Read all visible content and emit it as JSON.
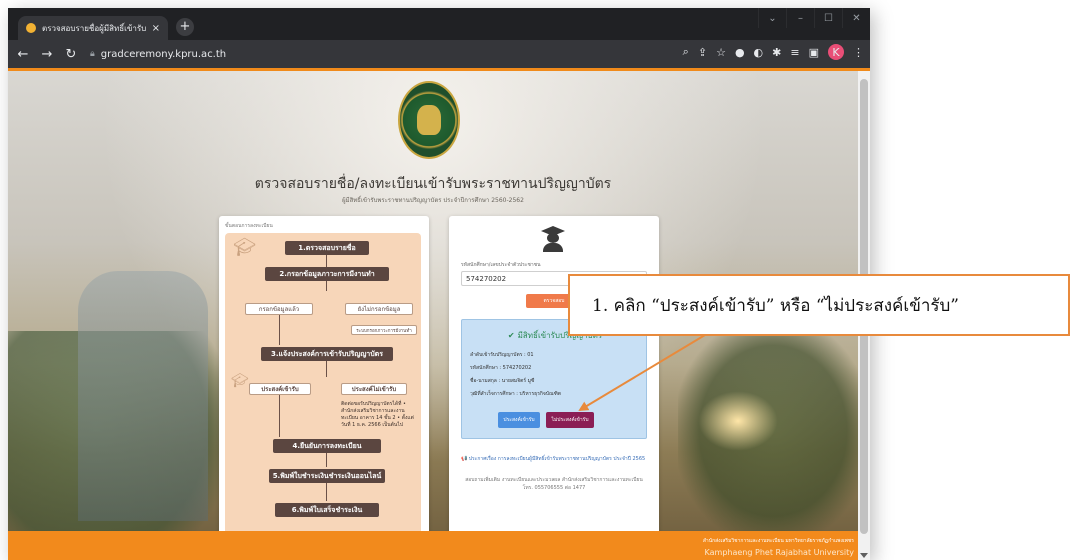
{
  "browser": {
    "tab_title": "ตรวจสอบรายชื่อผู้มีสิทธิ์เข้ารับพร",
    "tab_close": "×",
    "new_tab": "+",
    "url": "gradceremony.kpru.ac.th",
    "profile_initial": "K",
    "window_controls": [
      "⌄",
      "–",
      "☐",
      "✕"
    ],
    "icons": [
      "back-icon",
      "forward-icon",
      "reload-icon",
      "home-icon",
      "lock-icon",
      "zoom-icon",
      "share-icon",
      "bookmark-star-icon",
      "extension-icon",
      "extension-icon",
      "puzzle-icon",
      "reading-list-icon",
      "sidepanel-icon",
      "profile-icon",
      "menu-icon"
    ],
    "accent_color": "#f08a1a"
  },
  "page": {
    "title": "ตรวจสอบรายชื่อ/ลงทะเบียนเข้ารับพระราชทานปริญญาบัตร",
    "subtitle": "ผู้มีสิทธิ์เข้ารับพระราชทานปริญญาบัตร ประจำปีการศึกษา 2560-2562"
  },
  "steps": {
    "heading": "ขั้นตอนการลงทะเบียน",
    "step1": "1.ตรวจสอบรายชื่อ",
    "step2": "2.กรอกข้อมูลภาวะการมีงานทำ",
    "branch_done": "กรอกข้อมูลแล้ว",
    "branch_not_done": "ยังไม่กรอกข้อมูล",
    "branch_system": "ระบบกรอกภาวะการมีงานทำ",
    "step3": "3.แจ้งประสงค์การเข้ารับปริญญาบัตร",
    "option_accept": "ประสงค์เข้ารับ",
    "option_decline": "ประสงค์ไม่เข้ารับ",
    "decline_note": "ติดต่อขอรับปริญญาบัตรได้ที่ • สำนักส่งเสริมวิชาการและงานทะเบียน อาคาร 14 ชั้น 2 • ตั้งแต่วันที่ 1 ธ.ค. 2566 เป็นต้นไป",
    "step4": "4.ยืนยันการลงทะเบียน",
    "step5": "5.พิมพ์ใบชำระเงินชำระเงินออนไลน์",
    "step6": "6.พิมพ์ใบเสร็จชำระเงิน"
  },
  "login": {
    "field_label": "รหัสนักศึกษา/เลขประจำตัวประชาชน",
    "student_id": "574270202",
    "check_button": "ตรวจสอบ",
    "eligible_text": "มีสิทธิ์เข้ารับปริญญาบัตร",
    "info": [
      "ลำดับเข้ารับปริญญาบัตร : 01",
      "รหัสนักศึกษา : 574270202",
      "ชื่อ-นามสกุล : นายสมจิตร์ มูซี",
      "วุฒิที่สำเร็จการศึกษา : บริหารธุรกิจบัณฑิต"
    ],
    "accept_button": "ประสงค์เข้ารับ",
    "decline_button": "ไม่ประสงค์เข้ารับ",
    "notice": "📢 ประกาศเรื่อง การลงทะเบียนผู้มีสิทธิ์เข้ารับพระราชทานปริญญาบัตร ประจำปี 2565",
    "contact_line1": "สอบถามเพิ่มเติม งานทะเบียนและประมวลผล สำนักส่งเสริมวิชาการและงานทะเบียน",
    "contact_line2": "โทร. 055706555 ต่อ 1477"
  },
  "footer": {
    "thai": "สำนักส่งเสริมวิชาการและงานทะเบียน มหาวิทยาลัยราชภัฏกำแพงเพชร",
    "english": "Kamphaeng Phet Rajabhat University"
  },
  "annotation": {
    "text": "1. คลิก “ประสงค์เข้ารับ” หรือ “ไม่ประสงค์เข้ารับ”",
    "color": "#e88a3c"
  },
  "colors": {
    "footer_orange": "#f28a1c",
    "decline_button": "#8b1e55",
    "accept_button": "#4a8fe0",
    "eligible_green": "#2e8b57"
  }
}
